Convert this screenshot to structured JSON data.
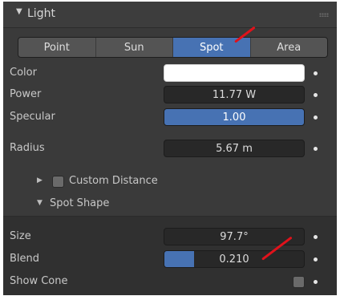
{
  "panel": {
    "title": "Light",
    "collapse_arrow_icon": "triangle-down-icon"
  },
  "light_types": {
    "options": [
      "Point",
      "Sun",
      "Spot",
      "Area"
    ],
    "selected": "Spot"
  },
  "properties": {
    "color": {
      "label": "Color",
      "value_hex": "#ffffff"
    },
    "power": {
      "label": "Power",
      "value": "11.77 W"
    },
    "specular": {
      "label": "Specular",
      "value": "1.00",
      "fill_fraction": 1.0
    },
    "radius": {
      "label": "Radius",
      "value": "5.67 m"
    }
  },
  "custom_distance": {
    "label": "Custom Distance",
    "checked": false
  },
  "spot_shape": {
    "label": "Spot Shape",
    "size": {
      "label": "Size",
      "value": "97.7°"
    },
    "blend": {
      "label": "Blend",
      "value": "0.210",
      "fill_fraction": 0.21
    },
    "show_cone": {
      "label": "Show Cone",
      "checked": false
    }
  },
  "colors": {
    "accent": "#4772b3",
    "panel": "#3a3a3a",
    "field": "#282828",
    "annotation": "#e0121b"
  }
}
